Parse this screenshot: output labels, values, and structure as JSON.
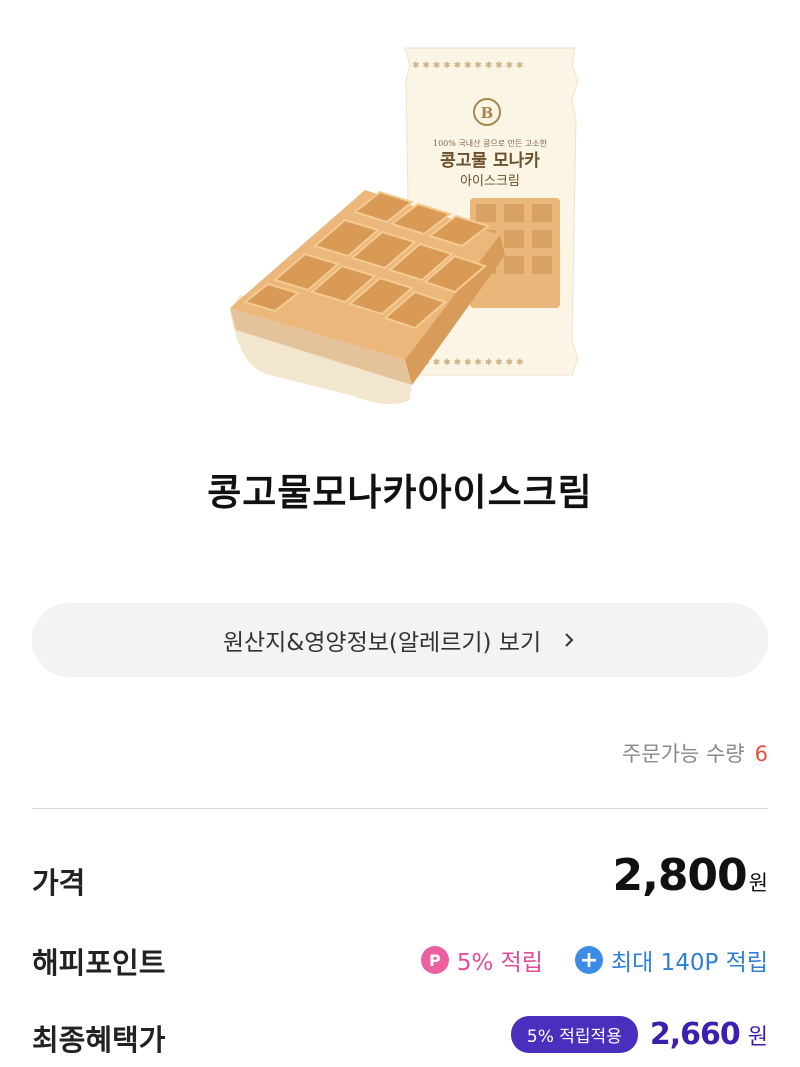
{
  "product": {
    "title": "콩고물모나카아이스크림",
    "package_tagline": "100% 국내산 콩으로 만든 고소한",
    "package_name_1": "콩고물 모나카",
    "package_name_2": "아이스크림",
    "package_logo": "B"
  },
  "info_button": {
    "label": "원산지&영양정보(알레르기) 보기"
  },
  "order": {
    "label": "주문가능 수량",
    "value": "6"
  },
  "price": {
    "label": "가격",
    "amount": "2,800",
    "currency": "원"
  },
  "happy_point": {
    "label": "해피포인트",
    "p_icon": "P",
    "rate_text": "5% 적립",
    "plus_icon": "+",
    "max_text": "최대 140P 적립"
  },
  "final_price": {
    "label": "최종혜택가",
    "badge": "5% 적립적용",
    "amount": "2,660",
    "currency": "원"
  },
  "colors": {
    "accent_pink": "#e34d98",
    "accent_blue": "#2f7fd6",
    "accent_purple": "#4a2fbf",
    "qty_red": "#e0503d"
  }
}
